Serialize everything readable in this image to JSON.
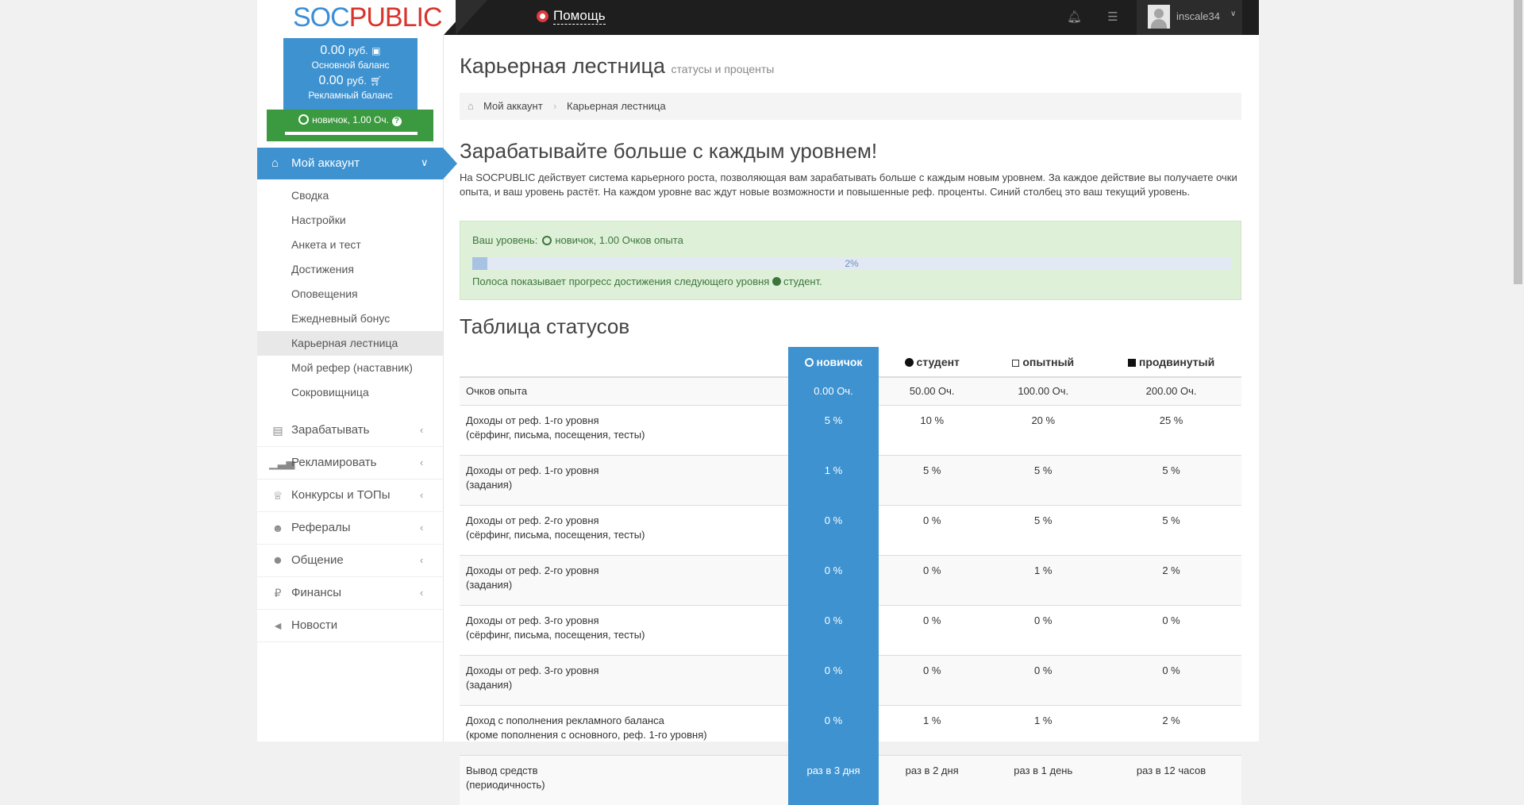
{
  "logo": {
    "part1": "SOC",
    "part2": "PUBLIC"
  },
  "topbar": {
    "help_label": "Помощь",
    "username": "inscale34"
  },
  "balance": {
    "main_amount": "0.00",
    "currency": "руб.",
    "main_label": "Основной баланс",
    "ad_amount": "0.00",
    "ad_label": "Рекламный баланс",
    "status": "новичок, 1.00 Оч."
  },
  "nav": {
    "active_label": "Мой аккаунт",
    "subitems": [
      "Сводка",
      "Настройки",
      "Анкета и тест",
      "Достижения",
      "Оповещения",
      "Ежедневный бонус",
      "Карьерная лестница",
      "Мой рефер (наставник)",
      "Сокровищница"
    ],
    "items": [
      {
        "label": "Зарабатывать",
        "icon": "briefcase-icon"
      },
      {
        "label": "Рекламировать",
        "icon": "bar-chart-icon"
      },
      {
        "label": "Конкурсы и ТОПы",
        "icon": "trophy-icon"
      },
      {
        "label": "Рефералы",
        "icon": "users-icon"
      },
      {
        "label": "Общение",
        "icon": "chat-icon"
      },
      {
        "label": "Финансы",
        "icon": "ruble-icon"
      },
      {
        "label": "Новости",
        "icon": "megaphone-icon"
      }
    ]
  },
  "page": {
    "title": "Карьерная лестница",
    "subtitle": "статусы и проценты",
    "breadcrumb": [
      "Мой аккаунт",
      "Карьерная лестница"
    ],
    "heading": "Зарабатывайте больше с каждым уровнем!",
    "intro": "На SOCPUBLIC действует система карьерного роста, позволяющая вам зарабатывать больше с каждым новым уровнем. За каждое действие вы получаете очки опыта, и ваш уровень растёт. На каждом уровне вас ждут новые возможности и повышенные реф. проценты. Синий столбец это ваш текущий уровень."
  },
  "level": {
    "label": "Ваш уровень:",
    "value": "новичок, 1.00 Очков опыта",
    "progress": 0.02,
    "progress_text": "2%",
    "hint_prefix": "Полоса показывает прогресс достижения следующего уровня",
    "hint_next": "студент."
  },
  "table": {
    "title": "Таблица статусов",
    "columns": [
      "новичок",
      "студент",
      "опытный",
      "продвинутый"
    ],
    "rows": [
      {
        "label1": "Очков опыта",
        "label2": "",
        "values": [
          "0.00 Оч.",
          "50.00 Оч.",
          "100.00 Оч.",
          "200.00 Оч."
        ]
      },
      {
        "label1": "Доходы от реф. 1-го уровня",
        "label2": "(сёрфинг, письма, посещения, тесты)",
        "values": [
          "5 %",
          "10 %",
          "20 %",
          "25 %"
        ]
      },
      {
        "label1": "Доходы от реф. 1-го уровня",
        "label2": "(задания)",
        "values": [
          "1 %",
          "5 %",
          "5 %",
          "5 %"
        ]
      },
      {
        "label1": "Доходы от реф. 2-го уровня",
        "label2": "(сёрфинг, письма, посещения, тесты)",
        "values": [
          "0 %",
          "0 %",
          "5 %",
          "5 %"
        ]
      },
      {
        "label1": "Доходы от реф. 2-го уровня",
        "label2": "(задания)",
        "values": [
          "0 %",
          "0 %",
          "1 %",
          "2 %"
        ]
      },
      {
        "label1": "Доходы от реф. 3-го уровня",
        "label2": "(сёрфинг, письма, посещения, тесты)",
        "values": [
          "0 %",
          "0 %",
          "0 %",
          "0 %"
        ]
      },
      {
        "label1": "Доходы от реф. 3-го уровня",
        "label2": "(задания)",
        "values": [
          "0 %",
          "0 %",
          "0 %",
          "0 %"
        ]
      },
      {
        "label1": "Доход с пополнения рекламного баланса",
        "label2": "(кроме пополнения с основного, реф. 1-го уровня)",
        "values": [
          "0 %",
          "1 %",
          "1 %",
          "2 %"
        ]
      },
      {
        "label1": "Вывод средств",
        "label2": "(периодичность)",
        "values": [
          "раз в 3 дня",
          "раз в 2 дня",
          "раз в 1 день",
          "раз в 12 часов"
        ]
      }
    ]
  },
  "colors": {
    "accent": "#3e92d0",
    "green": "#3b9a3f",
    "topbar": "#1e1e1e"
  }
}
